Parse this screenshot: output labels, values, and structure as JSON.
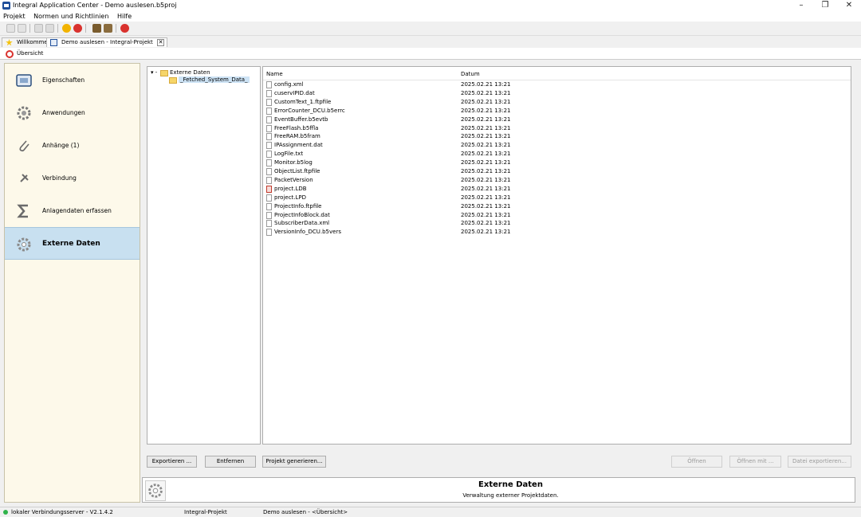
{
  "window": {
    "title": "Integral Application Center - Demo auslesen.b5proj"
  },
  "menu": [
    "Projekt",
    "Normen und Richtlinien",
    "Hilfe"
  ],
  "tabs": [
    {
      "label": "Willkommen"
    },
    {
      "label": "Demo auslesen - Integral-Projekt",
      "close": "✕"
    }
  ],
  "subtab": {
    "label": "Übersicht"
  },
  "sidebar": {
    "items": [
      {
        "label": "Eigenschaften",
        "icon": "properties-icon"
      },
      {
        "label": "Anwendungen",
        "icon": "gear-icon"
      },
      {
        "label": "Anhänge (1)",
        "icon": "paperclip-icon"
      },
      {
        "label": "Verbindung",
        "icon": "connection-plug-icon"
      },
      {
        "label": "Anlagendaten erfassen",
        "icon": "sigma-icon"
      },
      {
        "label": "Externe Daten",
        "icon": "external-data-gear-icon",
        "active": true
      }
    ]
  },
  "tree": {
    "root": "Externe Daten",
    "child": "_Fetched_System_Data_"
  },
  "files": {
    "columns": {
      "name": "Name",
      "date": "Datum"
    },
    "rows": [
      {
        "name": "config.xml",
        "date": "2025.02.21 13:21"
      },
      {
        "name": "cuservIPID.dat",
        "date": "2025.02.21 13:21"
      },
      {
        "name": "CustomText_1.ftpfile",
        "date": "2025.02.21 13:21"
      },
      {
        "name": "ErrorCounter_DCU.b5errc",
        "date": "2025.02.21 13:21"
      },
      {
        "name": "EventBuffer.b5evtb",
        "date": "2025.02.21 13:21"
      },
      {
        "name": "FreeFlash.b5ffla",
        "date": "2025.02.21 13:21"
      },
      {
        "name": "FreeRAM.b5fram",
        "date": "2025.02.21 13:21"
      },
      {
        "name": "IPAssignment.dat",
        "date": "2025.02.21 13:21"
      },
      {
        "name": "LogFile.txt",
        "date": "2025.02.21 13:21"
      },
      {
        "name": "Monitor.b5log",
        "date": "2025.02.21 13:21"
      },
      {
        "name": "ObjectList.ftpfile",
        "date": "2025.02.21 13:21"
      },
      {
        "name": "PacketVersion",
        "date": "2025.02.21 13:21"
      },
      {
        "name": "project.LDB",
        "date": "2025.02.21 13:21",
        "special": true
      },
      {
        "name": "project.LPD",
        "date": "2025.02.21 13:21"
      },
      {
        "name": "ProjectInfo.ftpfile",
        "date": "2025.02.21 13:21"
      },
      {
        "name": "ProjectInfoBlock.dat",
        "date": "2025.02.21 13:21"
      },
      {
        "name": "SubscriberData.xml",
        "date": "2025.02.21 13:21"
      },
      {
        "name": "VersionInfo_DCU.b5vers",
        "date": "2025.02.21 13:21"
      }
    ]
  },
  "buttons": {
    "export": "Exportieren ...",
    "remove": "Entfernen",
    "generate": "Projekt generieren...",
    "open": "Öffnen",
    "open_with": "Öffnen mit ...",
    "export_file": "Datei exportieren..."
  },
  "panel": {
    "title": "Externe Daten",
    "subtitle": "Verwaltung externer Projektdaten."
  },
  "status": {
    "server": "lokaler Verbindungsserver - V2.1.4.2",
    "project_type": "Integral-Projekt",
    "location": "Demo auslesen - <Übersicht>"
  }
}
